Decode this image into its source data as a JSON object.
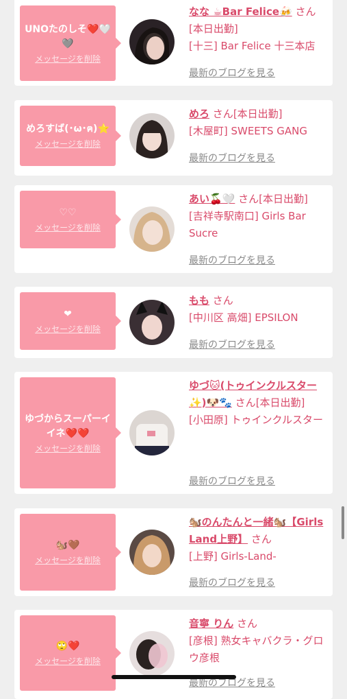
{
  "cards": [
    {
      "message": "UNOたのしそ❤️🤍🩶",
      "delete_label": "メッセージを削除",
      "name": "なな ☕Bar Felice🍻",
      "suffix": "さん",
      "status": "[本日出勤]",
      "shop": "[十三] Bar Felice 十三本店",
      "blog_label": "最新のブログを見る"
    },
    {
      "message": "めろすば(･ω･ฅ)⭐",
      "delete_label": "メッセージを削除",
      "name": "めろ",
      "suffix": "さん",
      "status": "[本日出勤]",
      "shop": "[木屋町] SWEETS GANG",
      "blog_label": "最新のブログを見る"
    },
    {
      "message": "♡♡",
      "delete_label": "メッセージを削除",
      "name": "あい🍒🤍",
      "suffix": "さん",
      "status": "[本日出勤]",
      "shop": "[吉祥寺駅南口] Girls Bar Sucre",
      "blog_label": "最新のブログを見る"
    },
    {
      "message": "❤",
      "delete_label": "メッセージを削除",
      "name": "もも",
      "suffix": "さん",
      "status": "",
      "shop": "[中川区 高畑] EPSILON",
      "blog_label": "最新のブログを見る"
    },
    {
      "message": "ゆづからスーパーイイネ❤️❤️",
      "delete_label": "メッセージを削除",
      "name": "ゆづ🐱(トゥインクルスター✨)🐶🐾",
      "suffix": "さん",
      "status": "[本日出勤]",
      "shop": "[小田原] トゥインクルスター",
      "blog_label": "最新のブログを見る"
    },
    {
      "message": "🐿️🤎",
      "delete_label": "メッセージを削除",
      "name": "🐿️のんたんと一緒🐿️【Girls Land上野】",
      "suffix": "さん",
      "status": "",
      "shop": "[上野] Girls-Land-",
      "blog_label": "最新のブログを見る"
    },
    {
      "message": "🙄❤️",
      "delete_label": "メッセージを削除",
      "name": "音寧 りん",
      "suffix": "さん",
      "status": "",
      "shop": "[彦根] 熟女キャバクラ・グロウ彦根",
      "blog_label": "最新のブログを見る"
    }
  ]
}
